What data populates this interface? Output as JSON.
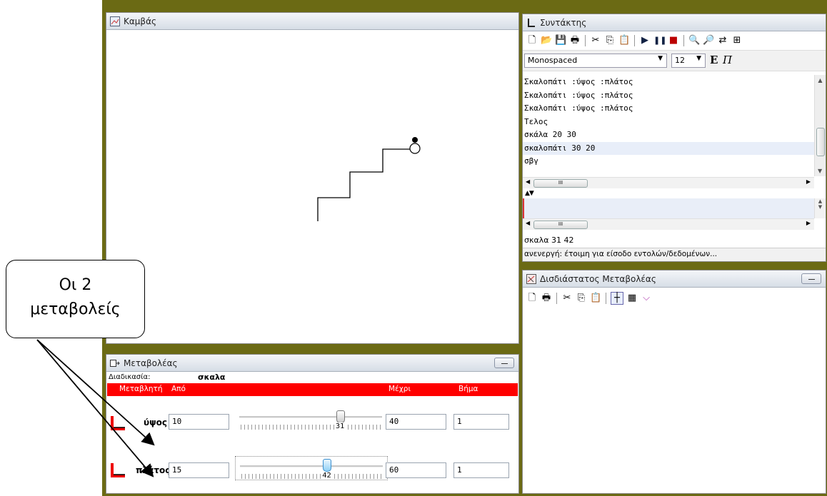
{
  "canvas_panel": {
    "title": "Καμβάς"
  },
  "editor": {
    "title": "Συντάκτης",
    "font_name": "Monospaced",
    "font_size": "12",
    "bold_label": "E",
    "italic_label": "Π",
    "code_lines": [
      "Σκαλοπάτι :ύψος :πλάτος",
      "Σκαλοπάτι :ύψος :πλάτος",
      "Σκαλοπάτι :ύψος :πλάτος",
      "Τελος",
      "σκάλα 20 30",
      "σκαλοπάτι 30 20",
      "σβγ"
    ],
    "hscroll_label": "III",
    "output_line": "σκαλα 31 42",
    "status_line": "ανενεργή: έτοιμη για είσοδο εντολών/δεδομένων..."
  },
  "manipulator_2d": {
    "title": "Δισδιάστατος Μεταβολέας"
  },
  "manipulator": {
    "title": "Μεταβολέας",
    "procedure_label": "Διαδικασία:",
    "procedure_name": "σκαλα",
    "headers": {
      "variable": "Μεταβλητή",
      "from": "Από",
      "to": "Μέχρι",
      "step": "Βήμα"
    },
    "rows": [
      {
        "name": "ύψος",
        "from": "10",
        "value": "31",
        "value_fraction": 0.7,
        "to": "40",
        "step": "1"
      },
      {
        "name": "πλάτος",
        "from": "15",
        "value": "42",
        "value_fraction": 0.6,
        "to": "60",
        "step": "1"
      }
    ]
  },
  "callout": {
    "line1": "Οι 2",
    "line2": "μεταβολείς"
  },
  "colors": {
    "desktop": "#6b6a14",
    "header_red": "#ff0000"
  }
}
